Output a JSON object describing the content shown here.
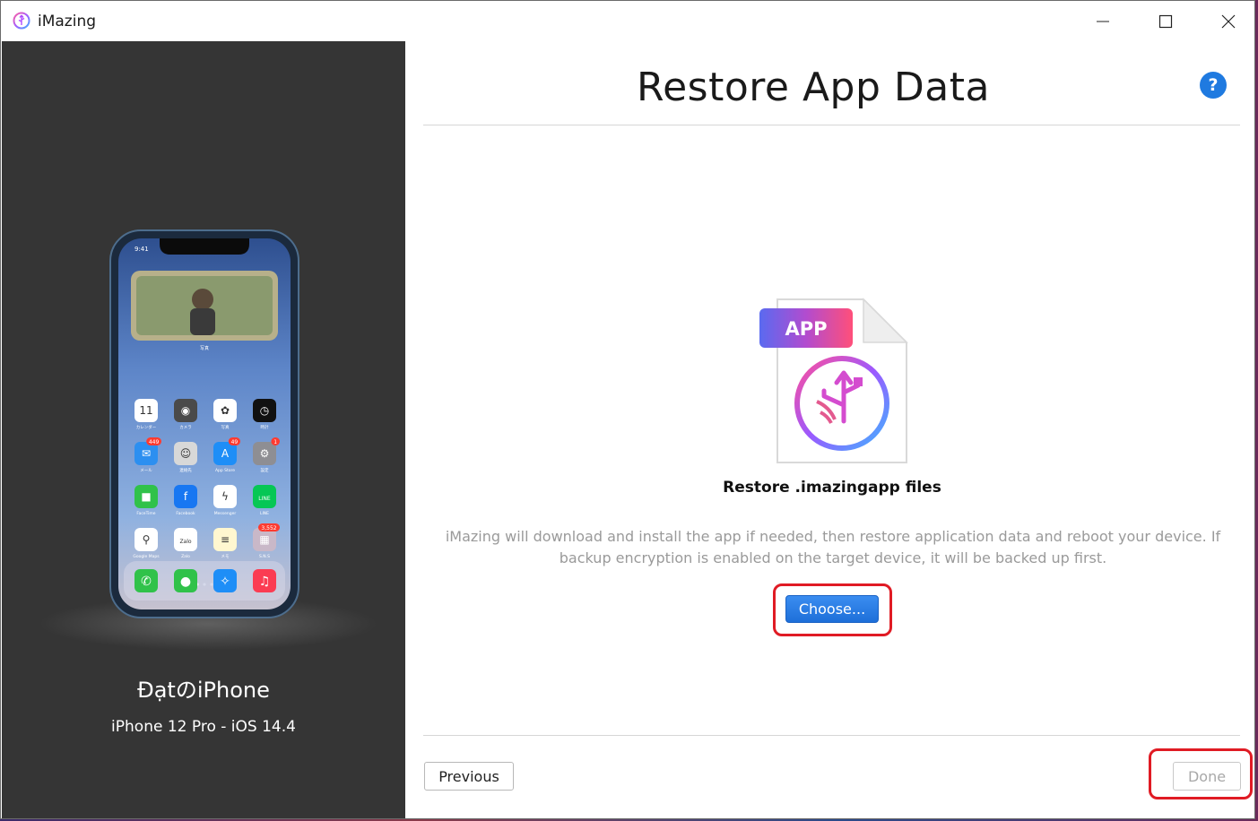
{
  "window": {
    "app_title": "iMazing",
    "controls": {
      "minimize": "minimize",
      "maximize": "maximize",
      "close": "close"
    }
  },
  "sidebar": {
    "device_name": "ĐạtのiPhone",
    "device_model": "iPhone 12 Pro - iOS 14.4",
    "phone_screen": {
      "status_time": "9:41",
      "widget_label": "写真",
      "apps": [
        {
          "name": "カレンダー",
          "icon": "calendar-icon",
          "color": "#ffffff",
          "glyph": "11"
        },
        {
          "name": "カメラ",
          "icon": "camera-icon",
          "color": "#4a4a4a",
          "glyph": "◉"
        },
        {
          "name": "写真",
          "icon": "photos-icon",
          "color": "#ffffff",
          "glyph": "✿"
        },
        {
          "name": "時計",
          "icon": "clock-icon",
          "color": "#111111",
          "glyph": "◷"
        },
        {
          "name": "メール",
          "icon": "mail-icon",
          "color": "#2c8ff0",
          "glyph": "✉",
          "badge": "449"
        },
        {
          "name": "連絡先",
          "icon": "contacts-icon",
          "color": "#d8d8d8",
          "glyph": "☺"
        },
        {
          "name": "App Store",
          "icon": "appstore-icon",
          "color": "#1e8ef7",
          "glyph": "A",
          "badge": "49"
        },
        {
          "name": "設定",
          "icon": "settings-icon",
          "color": "#8e8e93",
          "glyph": "⚙",
          "badge": "1"
        },
        {
          "name": "FaceTime",
          "icon": "facetime-icon",
          "color": "#30c24a",
          "glyph": "■"
        },
        {
          "name": "Facebook",
          "icon": "facebook-icon",
          "color": "#1877f2",
          "glyph": "f"
        },
        {
          "name": "Messenger",
          "icon": "messenger-icon",
          "color": "#ffffff",
          "glyph": "ϟ"
        },
        {
          "name": "LINE",
          "icon": "line-icon",
          "color": "#06c755",
          "glyph": "LINE"
        },
        {
          "name": "Google Maps",
          "icon": "googlemaps-icon",
          "color": "#ffffff",
          "glyph": "⚲"
        },
        {
          "name": "Zalo",
          "icon": "zalo-icon",
          "color": "#ffffff",
          "glyph": "Zalo"
        },
        {
          "name": "メモ",
          "icon": "notes-icon",
          "color": "#fff7d0",
          "glyph": "≡"
        },
        {
          "name": "S.N.S",
          "icon": "sns-folder-icon",
          "color": "#c9b8c8",
          "glyph": "▦",
          "badge": "3,552"
        }
      ],
      "dock": [
        {
          "icon": "phone-icon",
          "color": "#30c24a",
          "glyph": "✆"
        },
        {
          "icon": "messages-icon",
          "color": "#30c24a",
          "glyph": "●"
        },
        {
          "icon": "safari-icon",
          "color": "#1e8ef7",
          "glyph": "✧"
        },
        {
          "icon": "music-icon",
          "color": "#fb3c52",
          "glyph": "♫"
        }
      ]
    }
  },
  "main": {
    "title": "Restore App Data",
    "help_label": "?",
    "file_icon_tag": "APP",
    "file_caption": "Restore .imazingapp files",
    "description": "iMazing will download and install the app if needed, then restore application data and reboot your device. If backup encryption is enabled on the target device, it will be backed up first.",
    "choose_button": "Choose...",
    "previous_button": "Previous",
    "done_button": "Done"
  },
  "colors": {
    "sidebar_bg": "#353535",
    "accent_blue": "#1f7ae0",
    "highlight_red": "#e01b24"
  }
}
